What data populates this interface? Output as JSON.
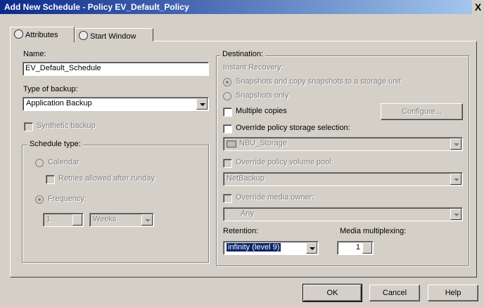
{
  "window": {
    "title": "Add New Schedule - Policy EV_Default_Policy",
    "close": "X"
  },
  "tabs": [
    {
      "label": "Attributes"
    },
    {
      "label": "Start Window"
    }
  ],
  "left": {
    "name_label": "Name:",
    "name_value": "EV_Default_Schedule",
    "type_label": "Type of backup:",
    "type_value": "Application Backup",
    "synthetic_label": "Synthetic backup",
    "schedule_type_legend": "Schedule type:",
    "calendar_label": "Calendar",
    "retries_label": "Retries allowed after runday",
    "frequency_label": "Frequency:",
    "freq_value": "1",
    "freq_unit": "Weeks"
  },
  "right": {
    "destination_legend": "Destination:",
    "instant_recovery": "Instant Recovery:",
    "snap_copy": "Snapshots and copy snapshots to a storage unit",
    "snap_only": "Snapshots only",
    "multiple_copies": "Multiple copies",
    "configure": "Configure...",
    "override_storage": "Override policy storage selection:",
    "storage_value": "NBU_Storage",
    "override_volume": "Override policy volume pool:",
    "volume_value": "NetBackup",
    "override_media": "Override media owner:",
    "media_value": "Any",
    "retention_label": "Retention:",
    "retention_value": "infinity (level 9)",
    "multiplexing_label": "Media multiplexing:",
    "multiplexing_value": "1"
  },
  "buttons": {
    "ok": "OK",
    "cancel": "Cancel",
    "help": "Help"
  }
}
